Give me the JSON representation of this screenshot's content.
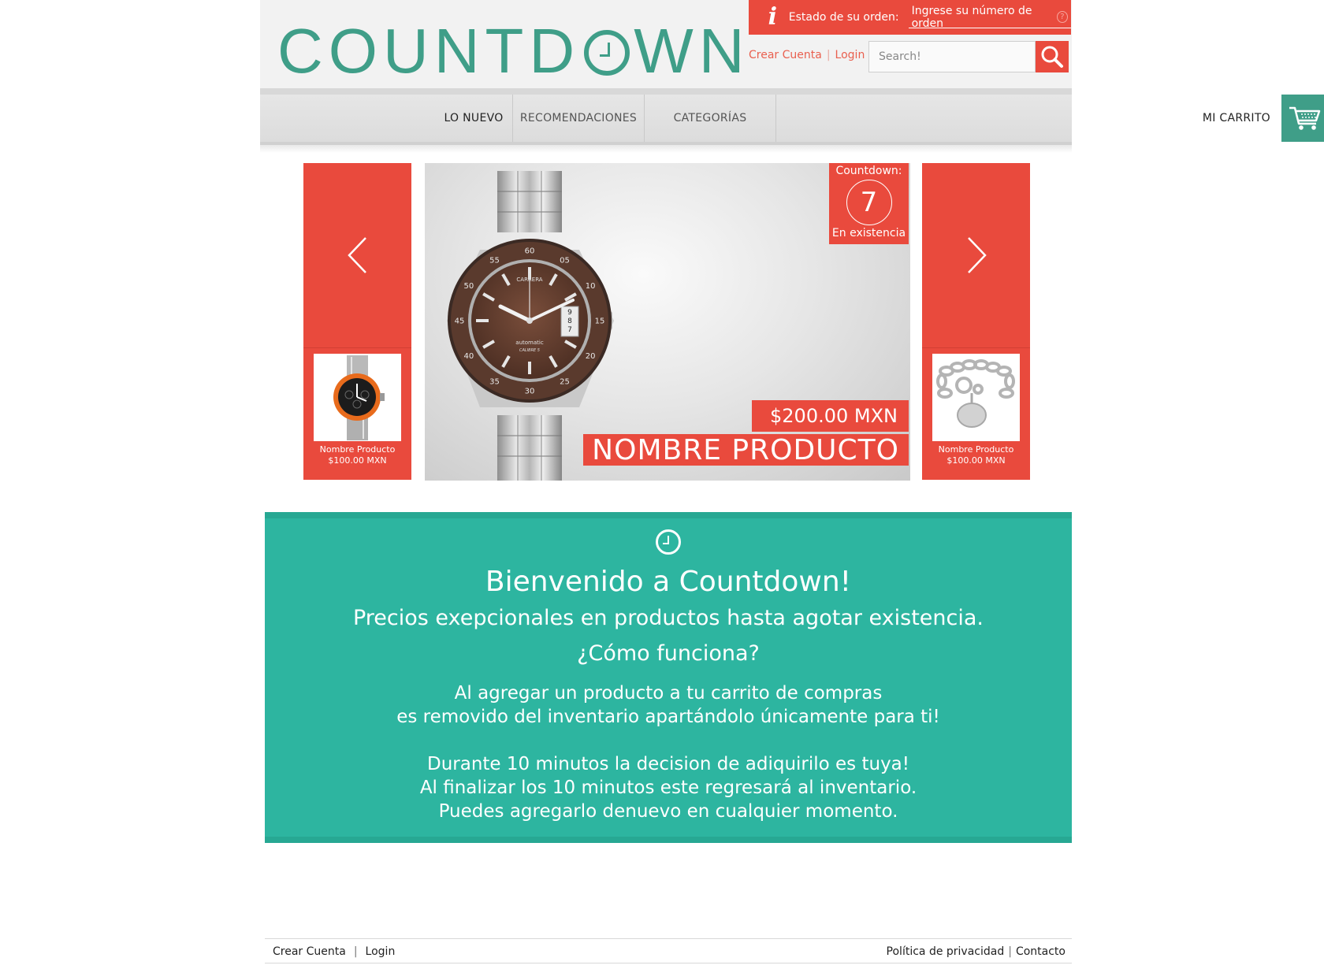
{
  "header": {
    "logo_text": "COUNTDOWN",
    "order_status": {
      "label": "Estado de su orden:",
      "placeholder": "Ingrese su número de orden",
      "help_icon": "?"
    },
    "account": {
      "create": "Crear Cuenta",
      "separator": "|",
      "login": "Login"
    },
    "search": {
      "placeholder": "Search!"
    }
  },
  "nav": {
    "items": [
      "LO NUEVO",
      "RECOMENDACIONES",
      "CATEGORÍAS"
    ],
    "cart_label": "MI CARRITO"
  },
  "carousel": {
    "left_product": {
      "name": "Nombre Producto",
      "price": "$100.00 MXN"
    },
    "right_product": {
      "name": "Nombre Producto",
      "price": "$100.00 MXN"
    },
    "featured": {
      "countdown_label": "Countdown:",
      "stock_count": "7",
      "stock_label": "En existencia",
      "price": "$200.00 MXN",
      "name": "NOMBRE PRODUCTO",
      "watch_brand": "CARRERA",
      "watch_text": "automatic",
      "watch_caliber": "CALIBRE 5",
      "bezel_numbers": [
        "60",
        "05",
        "10",
        "15",
        "20",
        "25",
        "30",
        "35",
        "40",
        "45",
        "50",
        "55"
      ],
      "date_digits": [
        "9",
        "8",
        "7"
      ]
    }
  },
  "welcome": {
    "title": "Bienvenido a Countdown!",
    "subtitle": "Precios exepcionales en productos hasta agotar existencia.",
    "question": "¿Cómo funciona?",
    "p1_line1": "Al agregar un producto a tu carrito de compras",
    "p1_line2": "es removido del inventario apartándolo únicamente para ti!",
    "p2_line1": "Durante 10 minutos la decision de adiquirilo es tuya!",
    "p2_line2": "Al finalizar los 10 minutos este regresará al inventario.",
    "p2_line3": "Puedes agregarlo denuevo en cualquier momento."
  },
  "footer": {
    "create": "Crear Cuenta",
    "login": "Login",
    "separator": "|",
    "privacy": "Política de privacidad",
    "contact": "Contacto"
  },
  "colors": {
    "brand_red": "#e94a3d",
    "brand_teal": "#2db5a0",
    "logo_green": "#3f9e88"
  },
  "icons": [
    "info-icon",
    "help-icon",
    "search-icon",
    "cart-icon",
    "chevron-left-icon",
    "chevron-right-icon",
    "clock-icon"
  ]
}
